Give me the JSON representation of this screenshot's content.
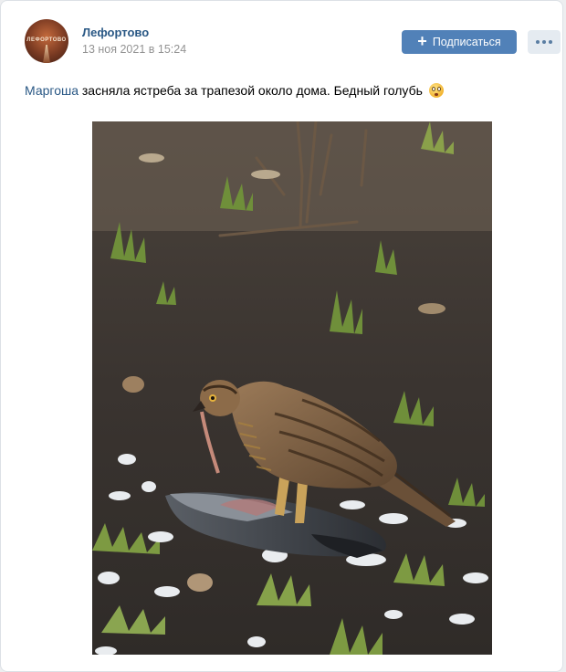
{
  "post": {
    "group_name": "Лефортово",
    "date": "13 ноя 2021 в 15:24",
    "subscribe_label": "Подписаться",
    "author_mention": "Маргоша",
    "text": " засняла ястреба за трапезой около дома. Бедный голубь",
    "avatar_text": "ЛЕФОРТОВО"
  },
  "icons": {
    "subscribe": "plus-icon",
    "more": "more-dots-icon",
    "emoji": "flushed-face-emoji"
  },
  "colors": {
    "link": "#2a5885",
    "button": "#5181b8",
    "secondary_button": "#e5ebf1",
    "muted_text": "#939393",
    "page_bg": "#edeef0"
  }
}
